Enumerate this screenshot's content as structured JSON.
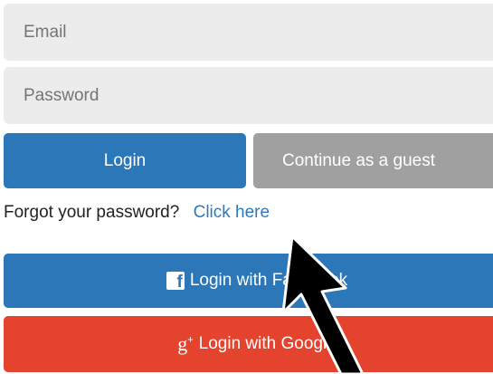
{
  "form": {
    "email_placeholder": "Email",
    "password_placeholder": "Password"
  },
  "buttons": {
    "login_label": "Login",
    "guest_label": "Continue as a guest",
    "facebook_label": "Login with Facebook",
    "google_label": "Login with Google"
  },
  "forgot": {
    "prompt": "Forgot your password?",
    "link": "Click here"
  },
  "icons": {
    "facebook": "facebook-icon",
    "google": "google-plus-icon",
    "annotation": "arrow-pointer"
  },
  "colors": {
    "primary": "#2b77b8",
    "guest": "#a0a0a0",
    "google": "#e4432e",
    "field_bg": "#ececec",
    "link": "#2f79b9"
  }
}
